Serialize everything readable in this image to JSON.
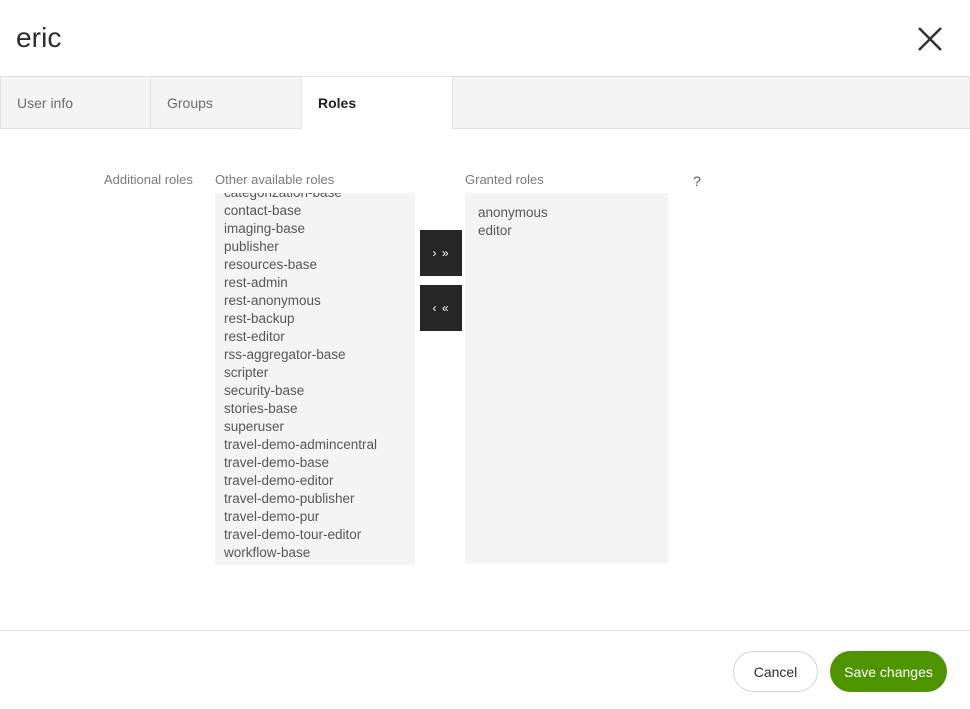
{
  "dialog": {
    "title": "eric",
    "close_icon": "close-icon"
  },
  "tabs": [
    {
      "label": "User info",
      "active": false
    },
    {
      "label": "Groups",
      "active": false
    },
    {
      "label": "Roles",
      "active": true
    }
  ],
  "roles_panel": {
    "additional_roles_label": "Additional roles",
    "other_available_roles_label": "Other available roles",
    "granted_roles_label": "Granted roles",
    "help_icon_label": "?",
    "add_button_label": "› »",
    "remove_button_label": "‹ «",
    "available_roles": [
      "categorization-base",
      "contact-base",
      "imaging-base",
      "publisher",
      "resources-base",
      "rest-admin",
      "rest-anonymous",
      "rest-backup",
      "rest-editor",
      "rss-aggregator-base",
      "scripter",
      "security-base",
      "stories-base",
      "superuser",
      "travel-demo-admincentral",
      "travel-demo-base",
      "travel-demo-editor",
      "travel-demo-publisher",
      "travel-demo-pur",
      "travel-demo-tour-editor",
      "workflow-base"
    ],
    "granted_roles": [
      "anonymous",
      "editor"
    ]
  },
  "footer": {
    "cancel_label": "Cancel",
    "save_label": "Save changes"
  },
  "colors": {
    "accent_green": "#4d9400",
    "panel_gray": "#f4f4f4",
    "button_dark": "#262626",
    "border_gray": "#e2e2e2"
  }
}
